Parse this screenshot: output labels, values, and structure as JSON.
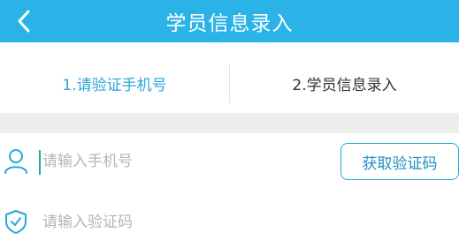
{
  "header": {
    "title": "学员信息录入",
    "back_icon": "chevron-left-icon",
    "background_color": "#2bb3e8"
  },
  "tabs": [
    {
      "label": "1.请验证手机号",
      "active": true,
      "color": "#2aa6dc"
    },
    {
      "label": "2.学员信息录入",
      "active": false,
      "color": "#333333"
    }
  ],
  "form": {
    "phone": {
      "icon": "user-icon",
      "placeholder": "请输入手机号",
      "value": ""
    },
    "get_code_button": {
      "label": "获取验证码"
    },
    "code": {
      "icon": "shield-check-icon",
      "placeholder": "请输入验证码",
      "value": ""
    }
  }
}
